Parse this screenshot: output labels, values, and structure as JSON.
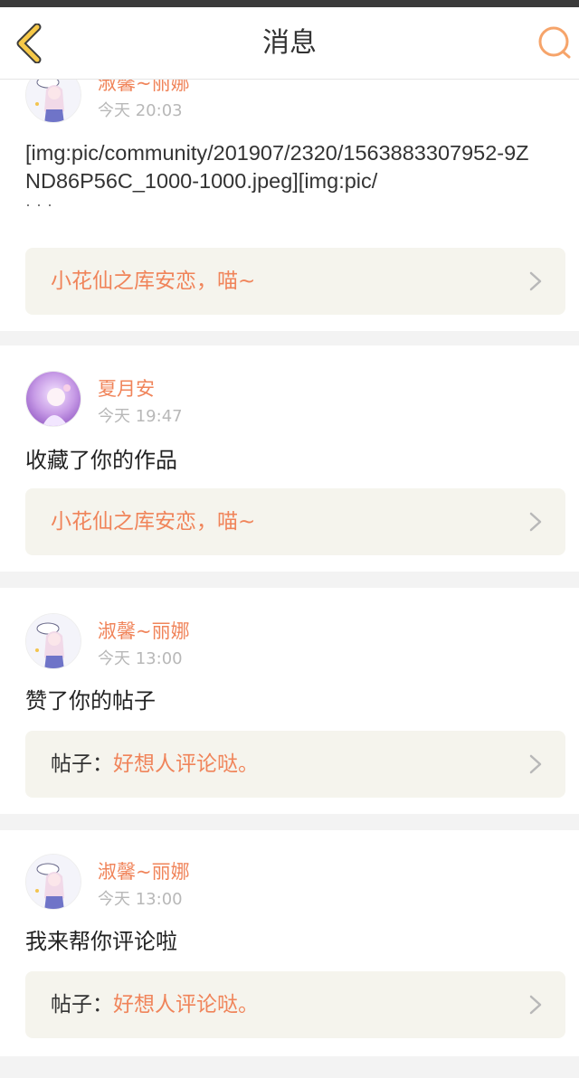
{
  "header": {
    "title": "消息",
    "back_icon": "chevron-left-icon",
    "search_icon": "search-icon",
    "accent": "#f7c948"
  },
  "colors": {
    "username": "#f0845a",
    "link_bg": "#f5f4ed",
    "divider": "#f3f3f3"
  },
  "messages": [
    {
      "username": "淑馨~丽娜",
      "time": "今天 20:03",
      "body": "[img:pic/community/201907/2320/1563883307952-9ZND86P56C_1000-1000.jpeg][img:pic/",
      "ellipsis": "···",
      "link_prefix": "",
      "link_text": "小花仙之库安恋，喵~"
    },
    {
      "username": "夏月安",
      "time": "今天 19:47",
      "body": "收藏了你的作品",
      "link_prefix": "",
      "link_text": "小花仙之库安恋，喵~"
    },
    {
      "username": "淑馨~丽娜",
      "time": "今天 13:00",
      "body": "赞了你的帖子",
      "link_prefix": "帖子：",
      "link_text": "好想人评论哒。"
    },
    {
      "username": "淑馨~丽娜",
      "time": "今天 13:00",
      "body": "我来帮你评论啦",
      "link_prefix": "帖子：",
      "link_text": "好想人评论哒。"
    }
  ]
}
